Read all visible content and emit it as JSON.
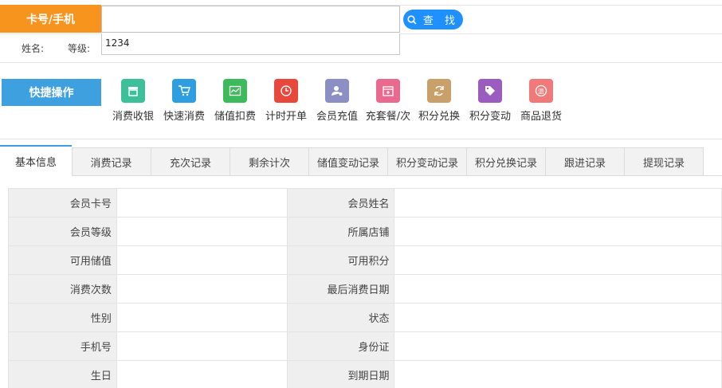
{
  "search": {
    "label": "卡号/手机",
    "value": "",
    "button": "查 找"
  },
  "member_meta": {
    "name_label": "姓名:",
    "level_label": "等级:",
    "suggestion": "1234"
  },
  "quick": {
    "label": "快捷操作",
    "items": [
      {
        "label": "消费收银",
        "icon": "cashier-icon",
        "color": "#3dbf9a"
      },
      {
        "label": "快速消费",
        "icon": "cart-icon",
        "color": "#2e9ee0"
      },
      {
        "label": "储值扣费",
        "icon": "chart-icon",
        "color": "#3cba5c"
      },
      {
        "label": "计时开单",
        "icon": "clock-icon",
        "color": "#e8473c"
      },
      {
        "label": "会员充值",
        "icon": "member-icon",
        "color": "#8b8fc4"
      },
      {
        "label": "充套餐/次",
        "icon": "package-icon",
        "color": "#ea6a8f"
      },
      {
        "label": "积分兑换",
        "icon": "refresh-icon",
        "color": "#c9a06a"
      },
      {
        "label": "积分变动",
        "icon": "tag-icon",
        "color": "#9b5cc0"
      },
      {
        "label": "商品退货",
        "icon": "return-icon",
        "color": "#f07a7a"
      }
    ]
  },
  "tabs": [
    {
      "label": "基本信息",
      "active": true
    },
    {
      "label": "消费记录"
    },
    {
      "label": "充次记录"
    },
    {
      "label": "剩余计次"
    },
    {
      "label": "储值变动记录"
    },
    {
      "label": "积分变动记录"
    },
    {
      "label": "积分兑换记录"
    },
    {
      "label": "跟进记录"
    },
    {
      "label": "提现记录"
    }
  ],
  "info_rows": [
    {
      "k1": "会员卡号",
      "v1": "",
      "k2": "会员姓名",
      "v2": ""
    },
    {
      "k1": "会员等级",
      "v1": "",
      "k2": "所属店铺",
      "v2": ""
    },
    {
      "k1": "可用储值",
      "v1": "",
      "k2": "可用积分",
      "v2": ""
    },
    {
      "k1": "消费次数",
      "v1": "",
      "k2": "最后消费日期",
      "v2": ""
    },
    {
      "k1": "性别",
      "v1": "",
      "k2": "状态",
      "v2": ""
    },
    {
      "k1": "手机号",
      "v1": "",
      "k2": "身份证",
      "v2": ""
    },
    {
      "k1": "生日",
      "v1": "",
      "k2": "到期日期",
      "v2": ""
    }
  ]
}
